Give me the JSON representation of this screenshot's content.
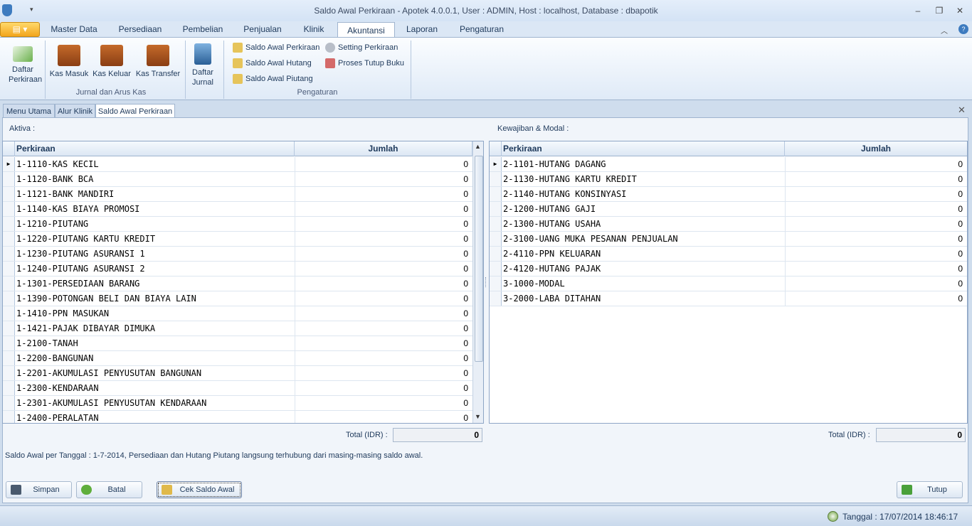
{
  "window": {
    "title": "Saldo Awal Perkiraan - Apotek 4.0.0.1,  User : ADMIN, Host : localhost, Database : dbapotik",
    "min": "–",
    "max": "❐",
    "close": "✕"
  },
  "ribbon_tabs": [
    "Master Data",
    "Persediaan",
    "Pembelian",
    "Penjualan",
    "Klinik",
    "Akuntansi",
    "Laporan",
    "Pengaturan"
  ],
  "ribbon": {
    "daftar_perkiraan": "Daftar Perkiraan",
    "kas_masuk": "Kas Masuk",
    "kas_keluar": "Kas Keluar",
    "kas_transfer": "Kas Transfer",
    "daftar_jurnal": "Daftar Jurnal",
    "group1": "Jurnal dan Arus Kas",
    "saldo_awal_perkiraan": "Saldo Awal Perkiraan",
    "saldo_awal_hutang": "Saldo Awal Hutang",
    "saldo_awal_piutang": "Saldo Awal Piutang",
    "setting_perkiraan": "Setting Perkiraan",
    "proses_tutup_buku": "Proses Tutup Buku",
    "group2": "Pengaturan"
  },
  "doc_tabs": [
    "Menu Utama",
    "Alur Klinik",
    "Saldo Awal Perkiraan"
  ],
  "aktiva": {
    "label": "Aktiva :",
    "col1": "Perkiraan",
    "col2": "Jumlah",
    "rows": [
      [
        "1-1110-KAS KECIL",
        "0"
      ],
      [
        "1-1120-BANK BCA",
        "0"
      ],
      [
        "1-1121-BANK MANDIRI",
        "0"
      ],
      [
        "1-1140-KAS BIAYA PROMOSI",
        "0"
      ],
      [
        "1-1210-PIUTANG",
        "0"
      ],
      [
        "1-1220-PIUTANG KARTU KREDIT",
        "0"
      ],
      [
        "1-1230-PIUTANG ASURANSI 1",
        "0"
      ],
      [
        "1-1240-PIUTANG ASURANSI 2",
        "0"
      ],
      [
        "1-1301-PERSEDIAAN BARANG",
        "0"
      ],
      [
        "1-1390-POTONGAN BELI DAN BIAYA LAIN",
        "0"
      ],
      [
        "1-1410-PPN MASUKAN",
        "0"
      ],
      [
        "1-1421-PAJAK DIBAYAR DIMUKA",
        "0"
      ],
      [
        "1-2100-TANAH",
        "0"
      ],
      [
        "1-2200-BANGUNAN",
        "0"
      ],
      [
        "1-2201-AKUMULASI PENYUSUTAN BANGUNAN",
        "0"
      ],
      [
        "1-2300-KENDARAAN",
        "0"
      ],
      [
        "1-2301-AKUMULASI PENYUSUTAN KENDARAAN",
        "0"
      ],
      [
        "1-2400-PERALATAN",
        "0"
      ]
    ],
    "total_label": "Total (IDR) :",
    "total_value": "0"
  },
  "kewajiban": {
    "label": "Kewajiban & Modal :",
    "col1": "Perkiraan",
    "col2": "Jumlah",
    "rows": [
      [
        "2-1101-HUTANG DAGANG",
        "0"
      ],
      [
        "2-1130-HUTANG KARTU KREDIT",
        "0"
      ],
      [
        "2-1140-HUTANG KONSINYASI",
        "0"
      ],
      [
        "2-1200-HUTANG GAJI",
        "0"
      ],
      [
        "2-1300-HUTANG USAHA",
        "0"
      ],
      [
        "2-3100-UANG MUKA PESANAN PENJUALAN",
        "0"
      ],
      [
        "2-4110-PPN KELUARAN",
        "0"
      ],
      [
        "2-4120-HUTANG PAJAK",
        "0"
      ],
      [
        "3-1000-MODAL",
        "0"
      ],
      [
        "3-2000-LABA DITAHAN",
        "0"
      ]
    ],
    "total_label": "Total (IDR) :",
    "total_value": "0"
  },
  "note": "Saldo Awal per Tanggal : 1-7-2014, Persediaan dan Hutang Piutang langsung terhubung dari masing-masing saldo awal.",
  "buttons": {
    "simpan": "Simpan",
    "batal": "Batal",
    "cek": "Cek Saldo Awal",
    "tutup": "Tutup"
  },
  "status": {
    "tanggal": "Tanggal : 17/07/2014 18:46:17"
  }
}
